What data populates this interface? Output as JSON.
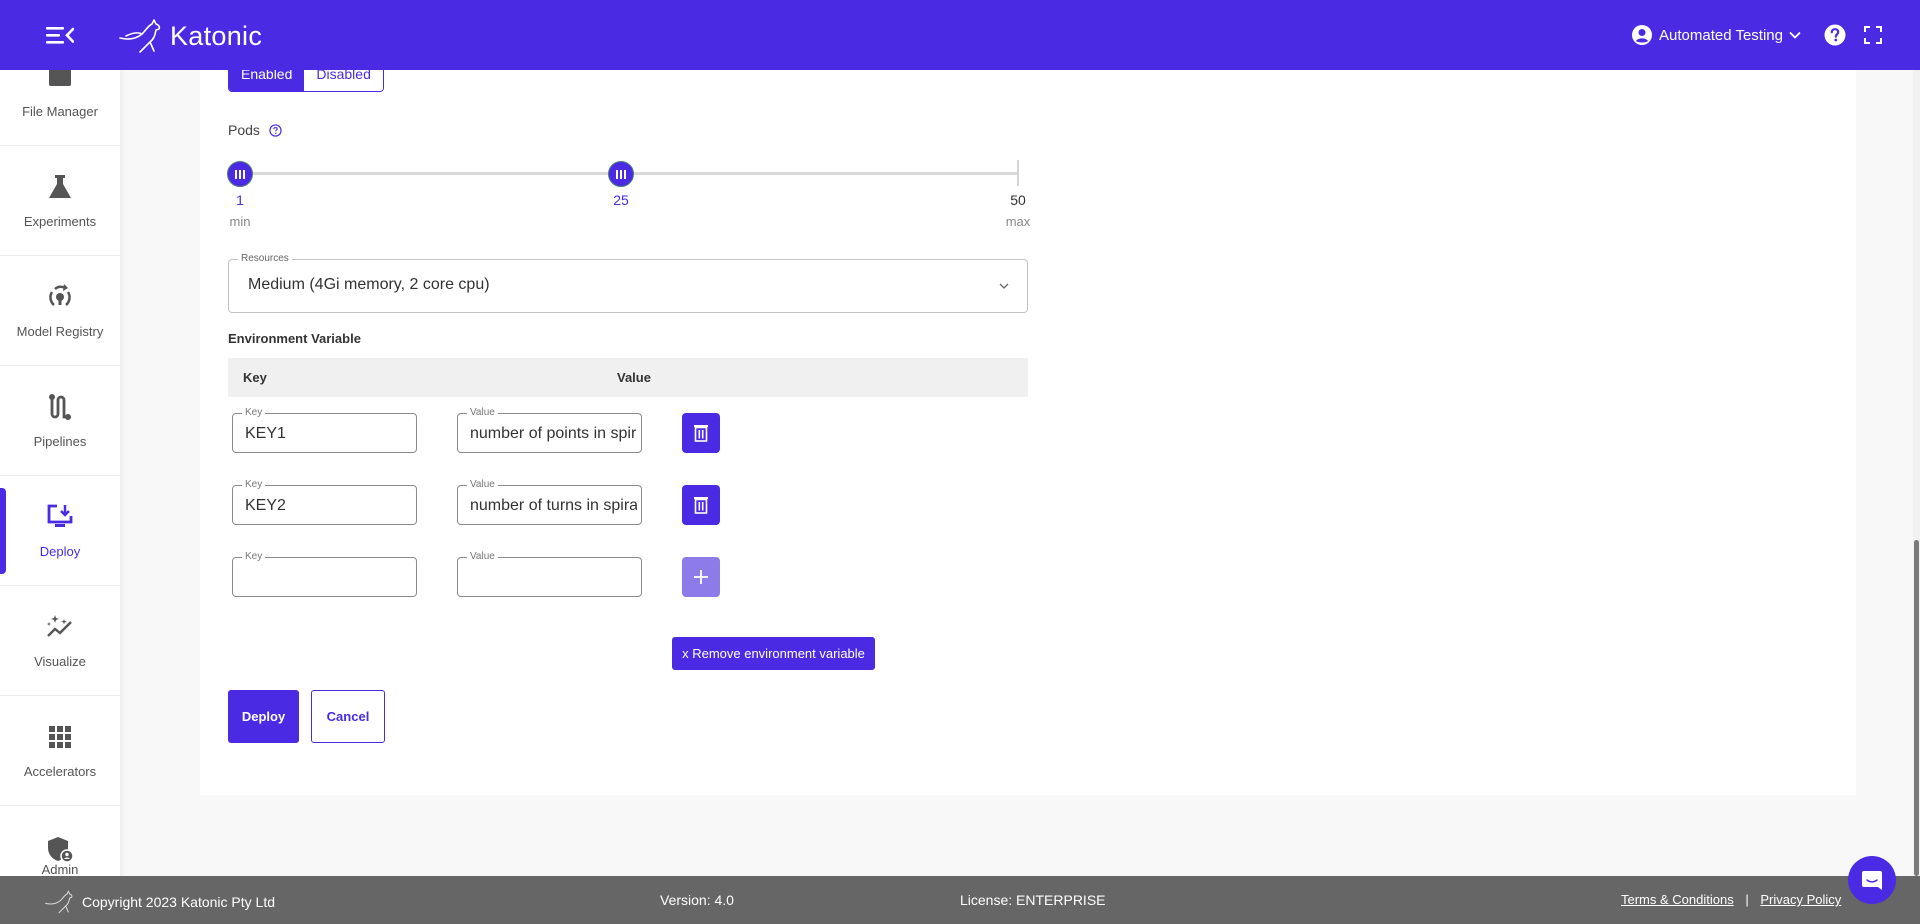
{
  "header": {
    "brand": "Katonic",
    "user_name": "Automated Testing"
  },
  "sidebar": {
    "items": [
      {
        "label": "File Manager",
        "icon": "folder-icon",
        "active": false
      },
      {
        "label": "Experiments",
        "icon": "flask-icon",
        "active": false
      },
      {
        "label": "Model Registry",
        "icon": "model-registry-icon",
        "active": false
      },
      {
        "label": "Pipelines",
        "icon": "pipeline-icon",
        "active": false
      },
      {
        "label": "Deploy",
        "icon": "deploy-monitor-icon",
        "active": true
      },
      {
        "label": "Visualize",
        "icon": "sparkle-chart-icon",
        "active": false
      },
      {
        "label": "Accelerators",
        "icon": "grid-icon",
        "active": false
      },
      {
        "label": "Admin",
        "icon": "admin-shield-icon",
        "active": false
      }
    ]
  },
  "form": {
    "autoscaling_toggle": {
      "enabled_label": "Enabled",
      "disabled_label": "Disabled",
      "selected": "Enabled"
    },
    "pods": {
      "label": "Pods",
      "min": 1,
      "max": 50,
      "selected_min": 1,
      "selected_max": 25,
      "min_value_label": "1",
      "selected_value_label": "25",
      "max_value_label": "50",
      "min_caption": "min",
      "max_caption": "max"
    },
    "resources": {
      "legend": "Resources",
      "value": "Medium (4Gi memory, 2 core cpu)"
    },
    "env": {
      "title": "Environment Variable",
      "col_key": "Key",
      "col_value": "Value",
      "key_legend": "Key",
      "value_legend": "Value",
      "rows": [
        {
          "key": "KEY1",
          "value": "number of points in spiral"
        },
        {
          "key": "KEY2",
          "value": "number of turns in spiral"
        },
        {
          "key": "",
          "value": ""
        }
      ],
      "remove_label": "x Remove environment variable"
    },
    "deploy_label": "Deploy",
    "cancel_label": "Cancel"
  },
  "footer": {
    "copyright": "Copyright 2023 Katonic Pty Ltd",
    "version": "Version: 4.0",
    "license": "License: ENTERPRISE",
    "terms": "Terms & Conditions",
    "separator": "|",
    "privacy": "Privacy Policy"
  },
  "colors": {
    "primary": "#4a2be3",
    "primary_light": "#8c7be9",
    "footer_bg": "#666666"
  }
}
